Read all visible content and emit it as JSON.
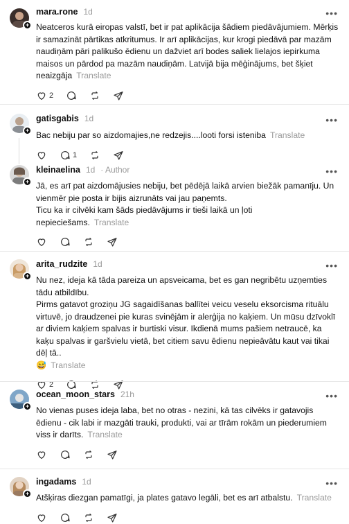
{
  "translate_label": "Translate",
  "posts": [
    {
      "username": "mara.rone",
      "time": "1d",
      "body": "Neatceros kurā eiropas valstī, bet ir pat aplikācija šādiem piedāvājumiem. Mērķis ir samazināt pārtikas atkritumus. Ir arī aplikācijas, kur krogi piedāvā par mazām naudiņām pāri palikušo ēdienu un dažviet arī bodes saliek lielajos iepirkuma maisos un pārdod pa mazām naudiņām. Latvijā bija mēģinājums, bet šķiet neaizgāja",
      "likes": "2",
      "replies": ""
    },
    {
      "username": "gatisgabis",
      "time": "1d",
      "body": "Bac nebiju par so aizdomajies,ne redzejis....looti forsi isteniba",
      "likes": "",
      "replies": "1"
    },
    {
      "username": "kleinaelina",
      "time": "1d",
      "author": "· Author",
      "body": "Jā, es arī pat aizdomājusies nebiju, bet pēdējā laikā arvien biežāk pamanīju. Un vienmēr pie posta ir bijis aizrunāts vai jau paņemts.\nTicu ka ir cilvēki kam šāds piedāvājums ir tieši laikā un ļoti nepieciešams.",
      "likes": "",
      "replies": ""
    },
    {
      "username": "arita_rudzite",
      "time": "1d",
      "body": "Nu nez, ideja kā tāda pareiza un apsveicama, bet es gan negribētu uzņemties tādu atbildību.\nPirms gatavot groziņu JG sagaidīšanas ballītei veicu veselu eksorcisma rituālu virtuvē, jo draudzenei pie kuras svinējām ir alerģija no kaķiem. Un mūsu dzīvoklī ar diviem kaķiem spalvas ir burtiski visur. Ikdienā mums pašiem netraucē, ka kaķu spalvas ir garšvielu vietā, bet citiem savu ēdienu nepieāvātu kaut vai tikai dēļ tā..",
      "emoji": "😅",
      "likes": "2",
      "replies": ""
    },
    {
      "username": "ocean_moon_stars",
      "time": "21h",
      "body": "No vienas puses ideja laba, bet no otras - nezini, kā tas cilvēks ir gatavojis ēdienu - cik labi ir mazgāti trauki, produkti, vai ar tīrām rokām un piederumiem viss ir darīts.",
      "likes": "",
      "replies": ""
    },
    {
      "username": "ingadams",
      "time": "1d",
      "body": "Atšķiras diezgan pamatīgi, ja plates gatavo legāli, bet es arī atbalstu.",
      "likes": "",
      "replies": ""
    }
  ]
}
